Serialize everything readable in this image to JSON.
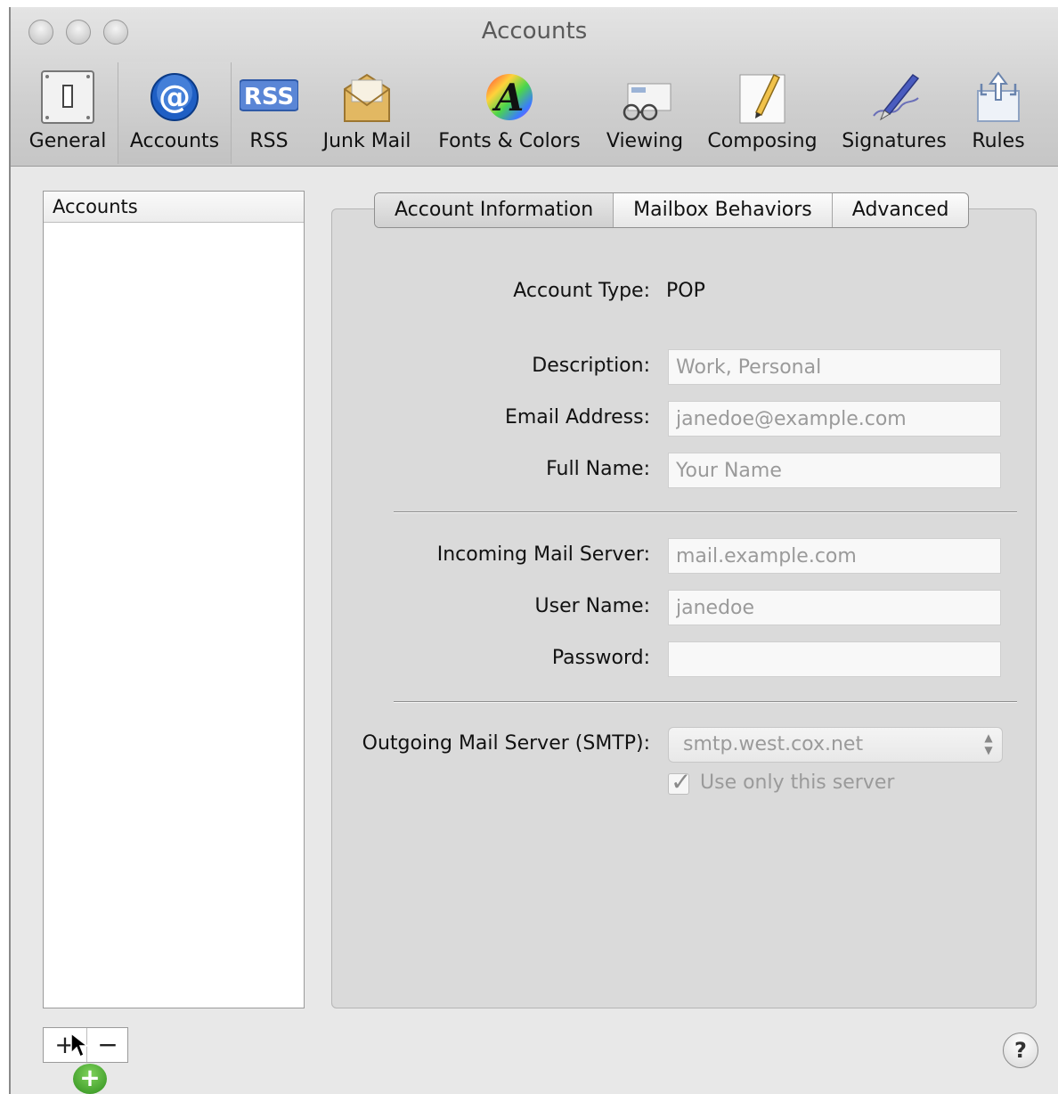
{
  "window": {
    "title": "Accounts"
  },
  "toolbar": {
    "items": [
      {
        "label": "General",
        "icon": "general-switch-icon"
      },
      {
        "label": "Accounts",
        "icon": "at-sign-icon"
      },
      {
        "label": "RSS",
        "icon": "rss-icon"
      },
      {
        "label": "Junk Mail",
        "icon": "junk-mail-envelope-icon"
      },
      {
        "label": "Fonts & Colors",
        "icon": "fonts-colors-icon"
      },
      {
        "label": "Viewing",
        "icon": "viewing-glasses-icon"
      },
      {
        "label": "Composing",
        "icon": "composing-pencil-icon"
      },
      {
        "label": "Signatures",
        "icon": "signature-pen-icon"
      },
      {
        "label": "Rules",
        "icon": "rules-arrows-icon"
      }
    ],
    "selected": "Accounts"
  },
  "sidebar": {
    "header": "Accounts",
    "add_label": "+",
    "remove_label": "−"
  },
  "tabs": [
    "Account Information",
    "Mailbox Behaviors",
    "Advanced"
  ],
  "active_tab": "Account Information",
  "form": {
    "account_type_label": "Account Type:",
    "account_type_value": "POP",
    "description_label": "Description:",
    "description_placeholder": "Work, Personal",
    "email_label": "Email Address:",
    "email_placeholder": "janedoe@example.com",
    "fullname_label": "Full Name:",
    "fullname_placeholder": "Your Name",
    "incoming_label": "Incoming Mail Server:",
    "incoming_placeholder": "mail.example.com",
    "username_label": "User Name:",
    "username_placeholder": "janedoe",
    "password_label": "Password:",
    "password_value": "",
    "smtp_label": "Outgoing Mail Server (SMTP):",
    "smtp_value": "smtp.west.cox.net",
    "use_only_label": "Use only this server",
    "use_only_checked": true
  },
  "help_label": "?"
}
